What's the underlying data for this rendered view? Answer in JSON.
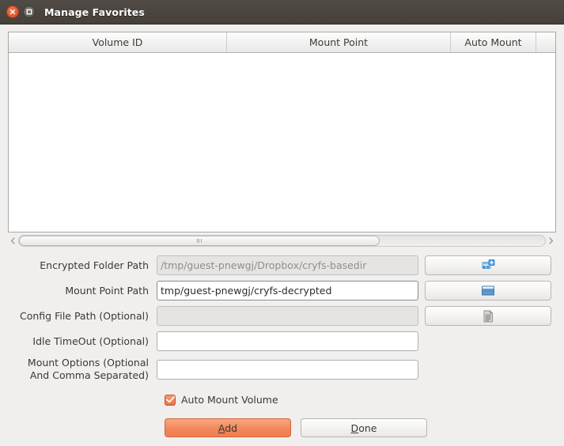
{
  "window": {
    "title": "Manage Favorites",
    "close_icon": "close-icon",
    "maximize_icon": "maximize-icon"
  },
  "table": {
    "columns": [
      "Volume ID",
      "Mount Point",
      "Auto Mount",
      ""
    ],
    "rows": []
  },
  "scrollbar": {
    "left_arrow_icon": "scroll-left-arrow-icon",
    "right_arrow_icon": "scroll-right-arrow-icon"
  },
  "form": {
    "fields": [
      {
        "label": "Encrypted Folder Path",
        "value": "",
        "placeholder": "/tmp/guest-pnewgj/Dropbox/cryfs-basedir",
        "disabled": true,
        "browse_icon": "folder-network-browse-icon"
      },
      {
        "label": "Mount Point Path",
        "value": "tmp/guest-pnewgj/cryfs-decrypted",
        "placeholder": "",
        "disabled": false,
        "browse_icon": "open-folder-browse-icon"
      },
      {
        "label": "Config File Path (Optional)",
        "value": "",
        "placeholder": "",
        "disabled": true,
        "browse_icon": "document-browse-icon"
      },
      {
        "label": "Idle TimeOut (Optional)",
        "value": "",
        "placeholder": "",
        "disabled": false,
        "browse_icon": ""
      },
      {
        "label": "Mount Options (Optional\nAnd Comma Separated)",
        "value": "",
        "placeholder": "",
        "disabled": false,
        "browse_icon": ""
      }
    ],
    "checkbox": {
      "label": "Auto Mount Volume",
      "checked": true
    },
    "buttons": {
      "add": "Add",
      "add_mnemonic": "A",
      "done": "Done",
      "done_mnemonic": "D"
    }
  },
  "colors": {
    "titlebar": "#4a453f",
    "body": "#f0efee",
    "accent_orange": "#ef7f51",
    "checkbox_orange": "#e8764a",
    "close_button": "#d9562c"
  }
}
